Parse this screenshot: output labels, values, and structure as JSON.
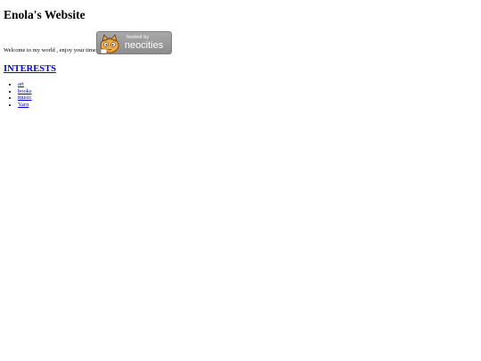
{
  "page": {
    "title": "Enola's Website",
    "welcome": "Welcome to my world , enjoy your time",
    "badge": {
      "line1": "hosted by",
      "line2": "neocities",
      "icon": "neocities-cat-icon"
    },
    "interests_heading": "INTERESTS",
    "interests": [
      "art",
      "books",
      "music",
      "Yarn"
    ]
  },
  "colors": {
    "link": "#0000ee",
    "badge": "#999999"
  }
}
